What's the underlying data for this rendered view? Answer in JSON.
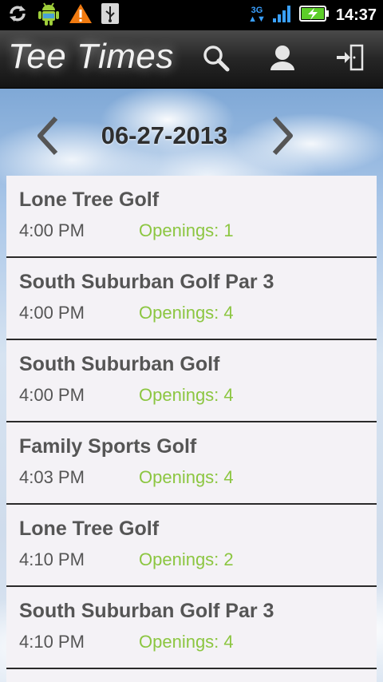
{
  "status_bar": {
    "time": "14:37",
    "network": "3G",
    "icons": [
      "sync-icon",
      "android-icon",
      "warning-icon",
      "usb-icon",
      "signal-icon",
      "battery-charging-icon"
    ]
  },
  "action_bar": {
    "title": "Tee Times",
    "actions": [
      "search-icon",
      "profile-icon",
      "logout-icon"
    ]
  },
  "date_nav": {
    "date": "06-27-2013",
    "prev_icon": "chevron-left-icon",
    "next_icon": "chevron-right-icon"
  },
  "tee_times": [
    {
      "course": "Lone Tree Golf",
      "time": "4:00 PM",
      "openings": "Openings: 1"
    },
    {
      "course": "South Suburban Golf Par 3",
      "time": "4:00 PM",
      "openings": "Openings: 4"
    },
    {
      "course": "South Suburban Golf",
      "time": "4:00 PM",
      "openings": "Openings: 4"
    },
    {
      "course": "Family Sports Golf",
      "time": "4:03 PM",
      "openings": "Openings: 4"
    },
    {
      "course": "Lone Tree Golf",
      "time": "4:10 PM",
      "openings": "Openings: 2"
    },
    {
      "course": "South Suburban Golf Par 3",
      "time": "4:10 PM",
      "openings": "Openings: 4"
    }
  ],
  "colors": {
    "openings_green": "#8cc641",
    "text_gray": "#555555",
    "row_background": "#f4f2f6"
  }
}
